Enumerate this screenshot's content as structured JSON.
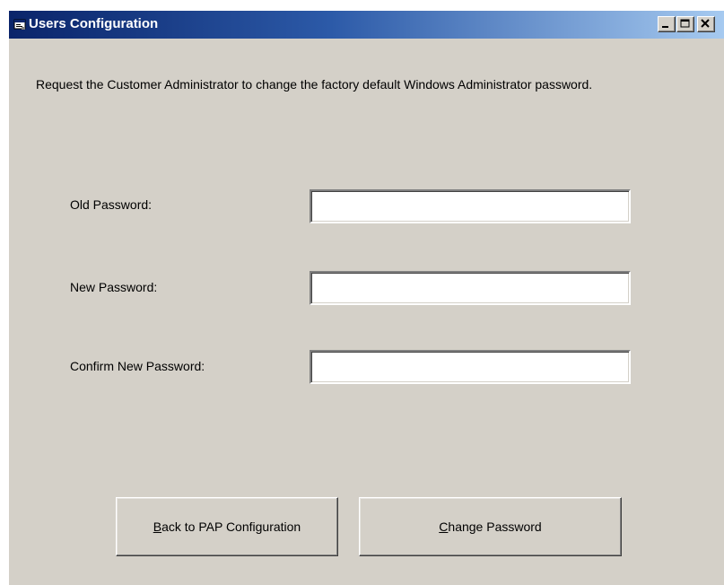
{
  "window": {
    "title": "Users Configuration",
    "icon": "app-window-icon",
    "controls": {
      "minimize_icon": "minimize-icon",
      "maximize_icon": "maximize-icon",
      "close_icon": "close-icon"
    }
  },
  "message": "Request the Customer Administrator to change the factory default Windows Administrator password.",
  "fields": {
    "old_password": {
      "label": "Old Password:",
      "value": ""
    },
    "new_password": {
      "label": "New Password:",
      "value": ""
    },
    "confirm_password": {
      "label": "Confirm New Password:",
      "value": ""
    }
  },
  "buttons": {
    "back": {
      "mnemonic": "B",
      "label_rest": "ack to PAP Configuration"
    },
    "change": {
      "mnemonic": "C",
      "label_rest": "hange Password"
    }
  },
  "colors": {
    "titlebar_start": "#0a246a",
    "titlebar_end": "#a6caf0",
    "face": "#d4d0c8"
  }
}
